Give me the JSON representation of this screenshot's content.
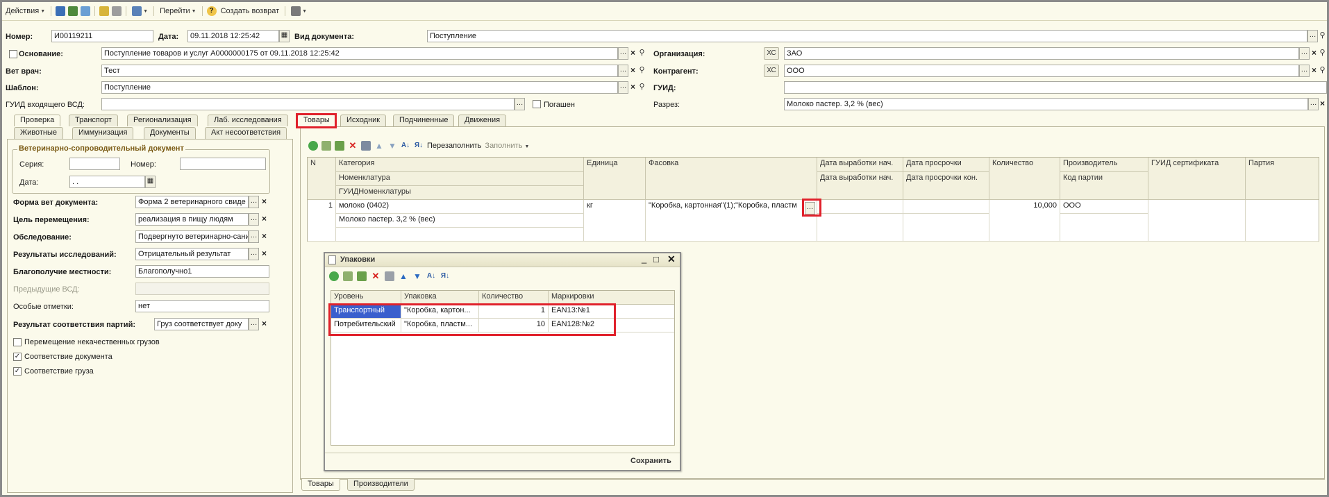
{
  "toolbar": {
    "actions": "Действия",
    "goto": "Перейти",
    "help": "?",
    "create_return": "Создать возврат"
  },
  "header": {
    "number_label": "Номер:",
    "number_value": "И00119211",
    "date_label": "Дата:",
    "date_value": "09.11.2018 12:25:42",
    "doc_type_label": "Вид документа:",
    "doc_type_value": "Поступление",
    "basis_label": "Основание:",
    "basis_value": "Поступление товаров и услуг А0000000175 от 09.11.2018 12:25:42",
    "org_label": "Организация:",
    "org_prefix": "ХС",
    "org_value": "ЗАО",
    "vet_label": "Вет врач:",
    "vet_value": "Тест",
    "contractor_label": "Контрагент:",
    "contractor_prefix": "ХС",
    "contractor_value": "ООО",
    "template_label": "Шаблон:",
    "template_value": "Поступление",
    "guid_label": "ГУИД:",
    "guid_value": "",
    "incoming_guid_label": "ГУИД входящего ВСД:",
    "incoming_guid_value": "",
    "repaid_label": "Погашен",
    "cut_label": "Разрез:",
    "cut_value": "Молоко пастер. 3,2 % (вес)"
  },
  "left_tabs": {
    "row1": [
      "Проверка",
      "Транспорт",
      "Регионализация",
      "Лаб. исследования"
    ],
    "row2": [
      "Животные",
      "Иммунизация",
      "Документы",
      "Акт несоответствия"
    ]
  },
  "left_panel": {
    "group_title": "Ветеринарно-сопроводительный документ",
    "series_label": "Серия:",
    "series_value": "",
    "number_label": "Номер:",
    "number_value": "",
    "date_label": "Дата:",
    "date_value": " .  .",
    "form_label": "Форма вет документа:",
    "form_value": "Форма 2 ветеринарного свиде",
    "purpose_label": "Цель перемещения:",
    "purpose_value": "реализация в пищу людям",
    "exam_label": "Обследование:",
    "exam_value": "Подвергнуто ветеринарно-сани",
    "results_label": "Результаты исследований:",
    "results_value": "Отрицательный результат",
    "wellbeing_label": "Благополучие местности:",
    "wellbeing_value": "Благополучно1",
    "prev_vsd_label": "Предыдущие ВСД:",
    "prev_vsd_value": "",
    "special_label": "Особые отметки:",
    "special_value": "нет",
    "batch_result_label": "Результат соответствия партий:",
    "batch_result_value": "Груз соответствует доку",
    "chk_lowquality_label": "Перемещение некачественных грузов",
    "chk_document_label": "Соответствие документа",
    "chk_cargo_label": "Соответствие груза"
  },
  "right_tabs": [
    "Товары",
    "Исходник",
    "Подчиненные",
    "Движения"
  ],
  "goods_toolbar": {
    "refill": "Перезаполнить",
    "fill": "Заполнить"
  },
  "goods_table": {
    "headers": {
      "n": "N",
      "category": "Категория",
      "nomenclature": "Номенклатура",
      "guid_nom": "ГУИДНоменклатуры",
      "unit": "Единица",
      "packing": "Фасовка",
      "prod_date": "Дата выработки нач.",
      "prod_date2": "Дата выработки нач.",
      "expiry": "Дата просрочки",
      "expiry2": "Дата просрочки кон.",
      "quantity": "Количество",
      "producer": "Производитель",
      "batch_code": "Код партии",
      "cert_guid": "ГУИД сертификата",
      "batch": "Партия"
    },
    "row": {
      "n": "1",
      "category": "молоко (0402)",
      "nomenclature": "Молоко пастер. 3,2 % (вес)",
      "unit": "кг",
      "packing": "\"Коробка, картонная\"(1);\"Коробка, пластм",
      "quantity": "10,000",
      "producer": "ООО"
    }
  },
  "packaging_window": {
    "title": "Упаковки",
    "headers": [
      "Уровень",
      "Упаковка",
      "Количество",
      "Маркировки"
    ],
    "rows": [
      {
        "level": "Транспортный",
        "pack": "\"Коробка, картон...",
        "qty": "1",
        "mark": "EAN13:№1"
      },
      {
        "level": "Потребительский",
        "pack": "\"Коробка, пластм...",
        "qty": "10",
        "mark": "EAN128:№2"
      }
    ],
    "save": "Сохранить"
  },
  "bottom_tabs": [
    "Товары",
    "Производители"
  ],
  "colors": {
    "background": "#fbfaeb",
    "highlight": "#e0212b",
    "selection": "#3a5fcd"
  }
}
